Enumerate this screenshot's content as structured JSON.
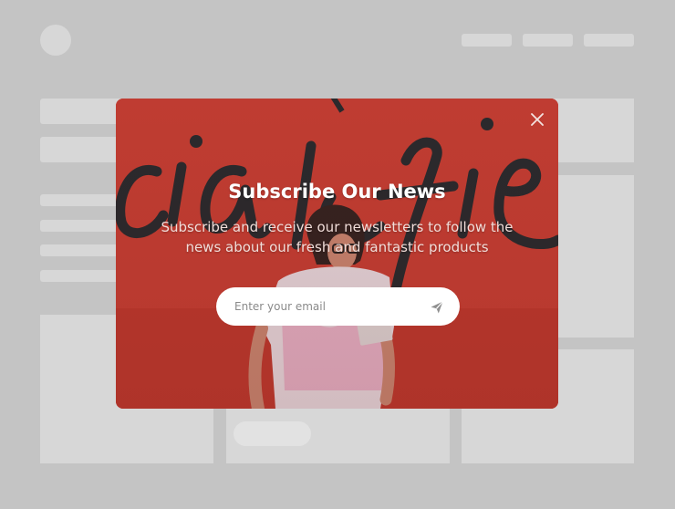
{
  "popup": {
    "title": "Subscribe Our News",
    "description": "Subscribe and receive our newsletters to follow the news about our fresh and fantastic products",
    "email_placeholder": "Enter your email",
    "close_icon": "close-icon",
    "submit_icon": "send-icon"
  },
  "colors": {
    "page_background": "#c4c4c4",
    "placeholder_block": "#d7d7d7",
    "popup_background": "#c43f34",
    "title_text": "#ffffff",
    "input_background": "#ffffff"
  }
}
